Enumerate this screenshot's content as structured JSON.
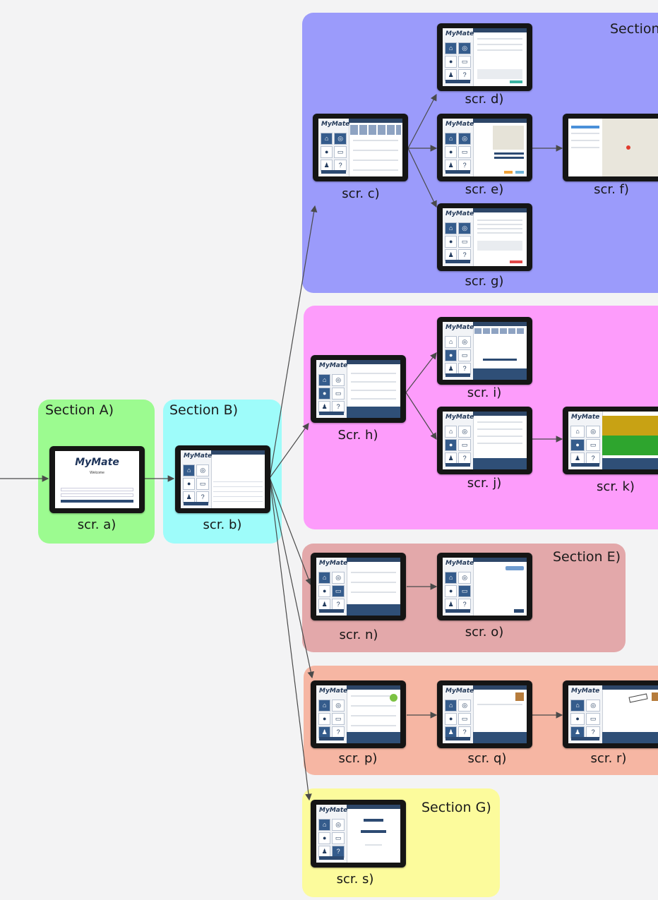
{
  "sections": {
    "a": {
      "title": "Section A)",
      "color": "#9cfb90"
    },
    "b": {
      "title": "Section B)",
      "color": "#9efcfa"
    },
    "c": {
      "title": "Section",
      "color": "#9b9bfb"
    },
    "d": {
      "title": "",
      "color": "#fd9cfb"
    },
    "e": {
      "title": "Section E)",
      "color": "#e3a8aa"
    },
    "f": {
      "title": "",
      "color": "#f6b6a3"
    },
    "g": {
      "title": "Section G)",
      "color": "#fcfb9c"
    }
  },
  "app": {
    "logo": "MyMate",
    "welcome": "Welcome"
  },
  "screens": [
    {
      "id": "a",
      "caption": "scr. a)"
    },
    {
      "id": "b",
      "caption": "scr. b)"
    },
    {
      "id": "c",
      "caption": "scr. c)"
    },
    {
      "id": "d",
      "caption": "scr. d)"
    },
    {
      "id": "e",
      "caption": "scr. e)"
    },
    {
      "id": "f",
      "caption": "scr. f)"
    },
    {
      "id": "g",
      "caption": "scr. g)"
    },
    {
      "id": "h",
      "caption": "Scr. h)"
    },
    {
      "id": "i",
      "caption": "scr. i)"
    },
    {
      "id": "j",
      "caption": "scr. j)"
    },
    {
      "id": "k",
      "caption": "scr. k)"
    },
    {
      "id": "n",
      "caption": "scr. n)"
    },
    {
      "id": "o",
      "caption": "scr. o)"
    },
    {
      "id": "p",
      "caption": "scr. p)"
    },
    {
      "id": "q",
      "caption": "scr. q)"
    },
    {
      "id": "r",
      "caption": "scr. r)"
    },
    {
      "id": "s",
      "caption": "scr. s)"
    }
  ],
  "icons": [
    "home-icon",
    "target-icon",
    "user-icon",
    "chat-icon",
    "people-icon",
    "help-icon"
  ],
  "arrow_color": "#4a4a4a"
}
